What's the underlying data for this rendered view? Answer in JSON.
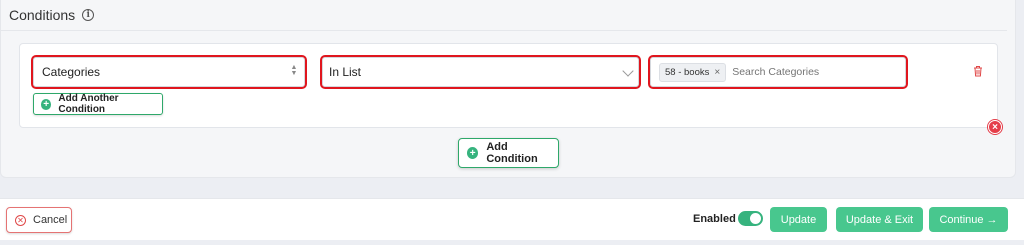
{
  "conditions_panel": {
    "title": "Conditions",
    "info_icon": "info-icon"
  },
  "condition_row": {
    "field_value": "Categories",
    "operator_value": "In List",
    "selected_tag": "58 - books",
    "tag_remove_glyph": "×",
    "search_placeholder": "Search Categories",
    "delete_icon": "trash-icon"
  },
  "add_another_condition_label": "Add Another Condition",
  "add_condition_label": "Add Condition",
  "footer": {
    "cancel_label": "Cancel",
    "enabled_label": "Enabled",
    "enabled_state": true,
    "update_label": "Update",
    "update_exit_label": "Update & Exit",
    "continue_label": "Continue →"
  },
  "colors": {
    "accent_green": "#48c78e",
    "danger_red": "#e53e4a",
    "highlight_outline": "#e0161e"
  }
}
